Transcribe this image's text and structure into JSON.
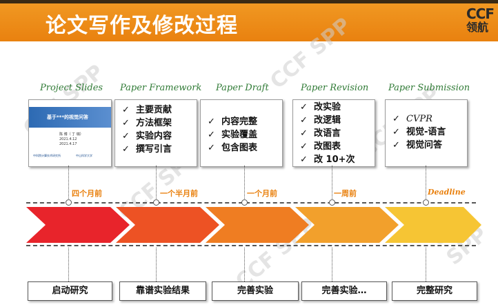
{
  "header": {
    "title": "论文写作及修改过程",
    "logo_line1": "CCF",
    "logo_line2": "领航"
  },
  "watermark": "CCF SPP",
  "stages": [
    {
      "label": "Project Slides"
    },
    {
      "label": "Paper  Framework",
      "items": [
        "主要贡献",
        "方法框架",
        "实验内容",
        "撰写引言"
      ]
    },
    {
      "label": "Paper  Draft",
      "items": [
        "内容完整",
        "实验覆盖",
        "包含图表"
      ]
    },
    {
      "label": "Paper  Revision",
      "items": [
        "改实验",
        "改逻辑",
        "改语言",
        "改图表",
        "改 10+次"
      ]
    },
    {
      "label": "Paper  Submission",
      "items": [
        "CVPR",
        "视觉-语言",
        "视觉问答"
      ]
    }
  ],
  "slide": {
    "title": "基于***的视觉问答",
    "author": "陈 博（ 丁 瑞）",
    "author_line2": "2021.4.12",
    "author_line3": "2021.4.17",
    "inst_left": "中科院计算技术研究所",
    "inst_right": "中山科学大学"
  },
  "timeline": [
    "四个月前",
    "一个半月前",
    "一个月前",
    "一周前",
    "Deadline"
  ],
  "bottom": [
    "启动研究",
    "靠谱实验结果",
    "完善实验",
    "完善实验…",
    "完整研究"
  ],
  "check": "✓",
  "colors": {
    "header_orange": "#e9810f",
    "stage_green": "#2f7a35",
    "arrow_red": "#e8242b",
    "arrow_orange": "#ef7d22",
    "arrow_yellow": "#f4b82d"
  }
}
